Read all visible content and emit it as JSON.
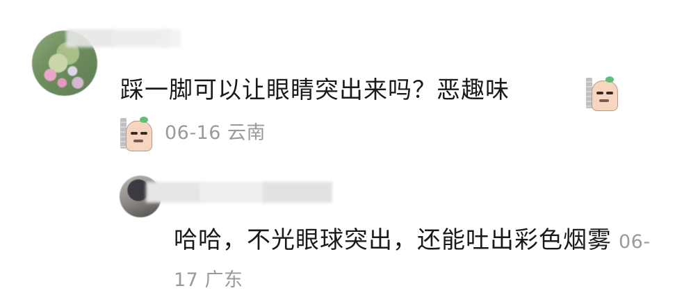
{
  "comment": {
    "avatar": "avatar-flowers",
    "name": "",
    "text": "踩一脚可以让眼睛突出来吗？恶趣味",
    "inline_sticker": "smirk-sticker-icon",
    "meta_sticker": "smirk-sticker-icon",
    "meta": "06-16 云南"
  },
  "reply": {
    "avatar": "avatar-dark",
    "name": "",
    "text": "哈哈，不光眼球突出，还能吐出彩色烟雾",
    "meta": "06-17 广东"
  }
}
